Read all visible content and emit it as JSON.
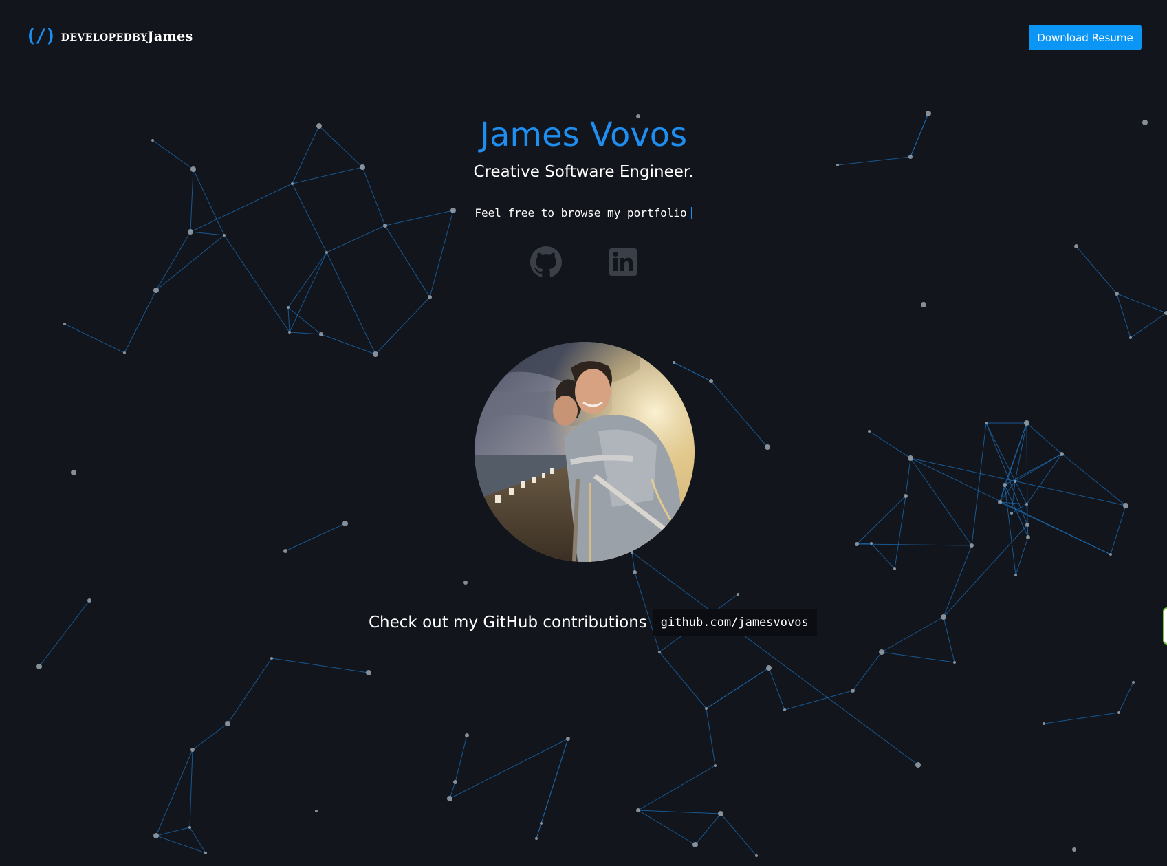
{
  "header": {
    "logo_glyph": "(/)",
    "logo_text_prefix": "developedby",
    "logo_text_name": "James",
    "resume_button_label": "Download Resume"
  },
  "hero": {
    "name": "James Vovos",
    "tagline": "Creative Software Engineer.",
    "typing_text": "Feel free to browse my portfolio"
  },
  "social": {
    "github_icon": "github-icon",
    "linkedin_icon": "linkedin-icon"
  },
  "contributions": {
    "label": "Check out my GitHub contributions",
    "link_text": "github.com/jamesvovos"
  },
  "colors": {
    "background": "#12151c",
    "accent": "#1f8ef1",
    "button": "#0b96f5",
    "icon_gray": "#3b3f47"
  }
}
